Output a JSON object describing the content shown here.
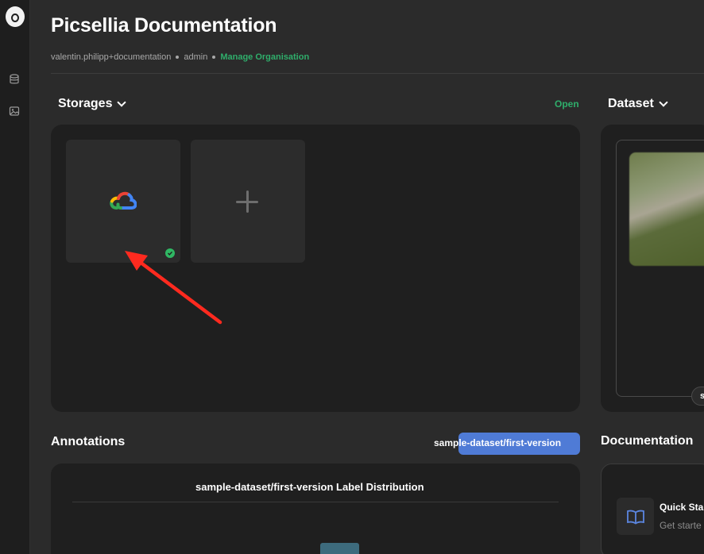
{
  "header": {
    "title": "Picsellia Documentation",
    "user": "valentin.philipp+documentation",
    "role": "admin",
    "manage_link": "Manage Organisation"
  },
  "sidebar": {
    "items": [
      {
        "icon": "database-icon"
      },
      {
        "icon": "image-icon"
      }
    ]
  },
  "storages": {
    "title": "Storages",
    "open_label": "Open",
    "tiles": [
      {
        "icon": "google-cloud-icon",
        "status": "connected"
      },
      {
        "icon": "plus-icon"
      }
    ]
  },
  "dataset": {
    "title": "Dataset",
    "badge": "s"
  },
  "annotations": {
    "title": "Annotations",
    "version_pill": "sample-dataset/first-version",
    "chart_title": "sample-dataset/first-version Label Distribution"
  },
  "documentation": {
    "title": "Documentation",
    "item_title": "Quick Sta",
    "item_sub": "Get starte"
  },
  "colors": {
    "accent_green": "#2fae6b",
    "pill_blue": "#4f7bd6",
    "annotation_arrow": "#ff2a1f"
  }
}
